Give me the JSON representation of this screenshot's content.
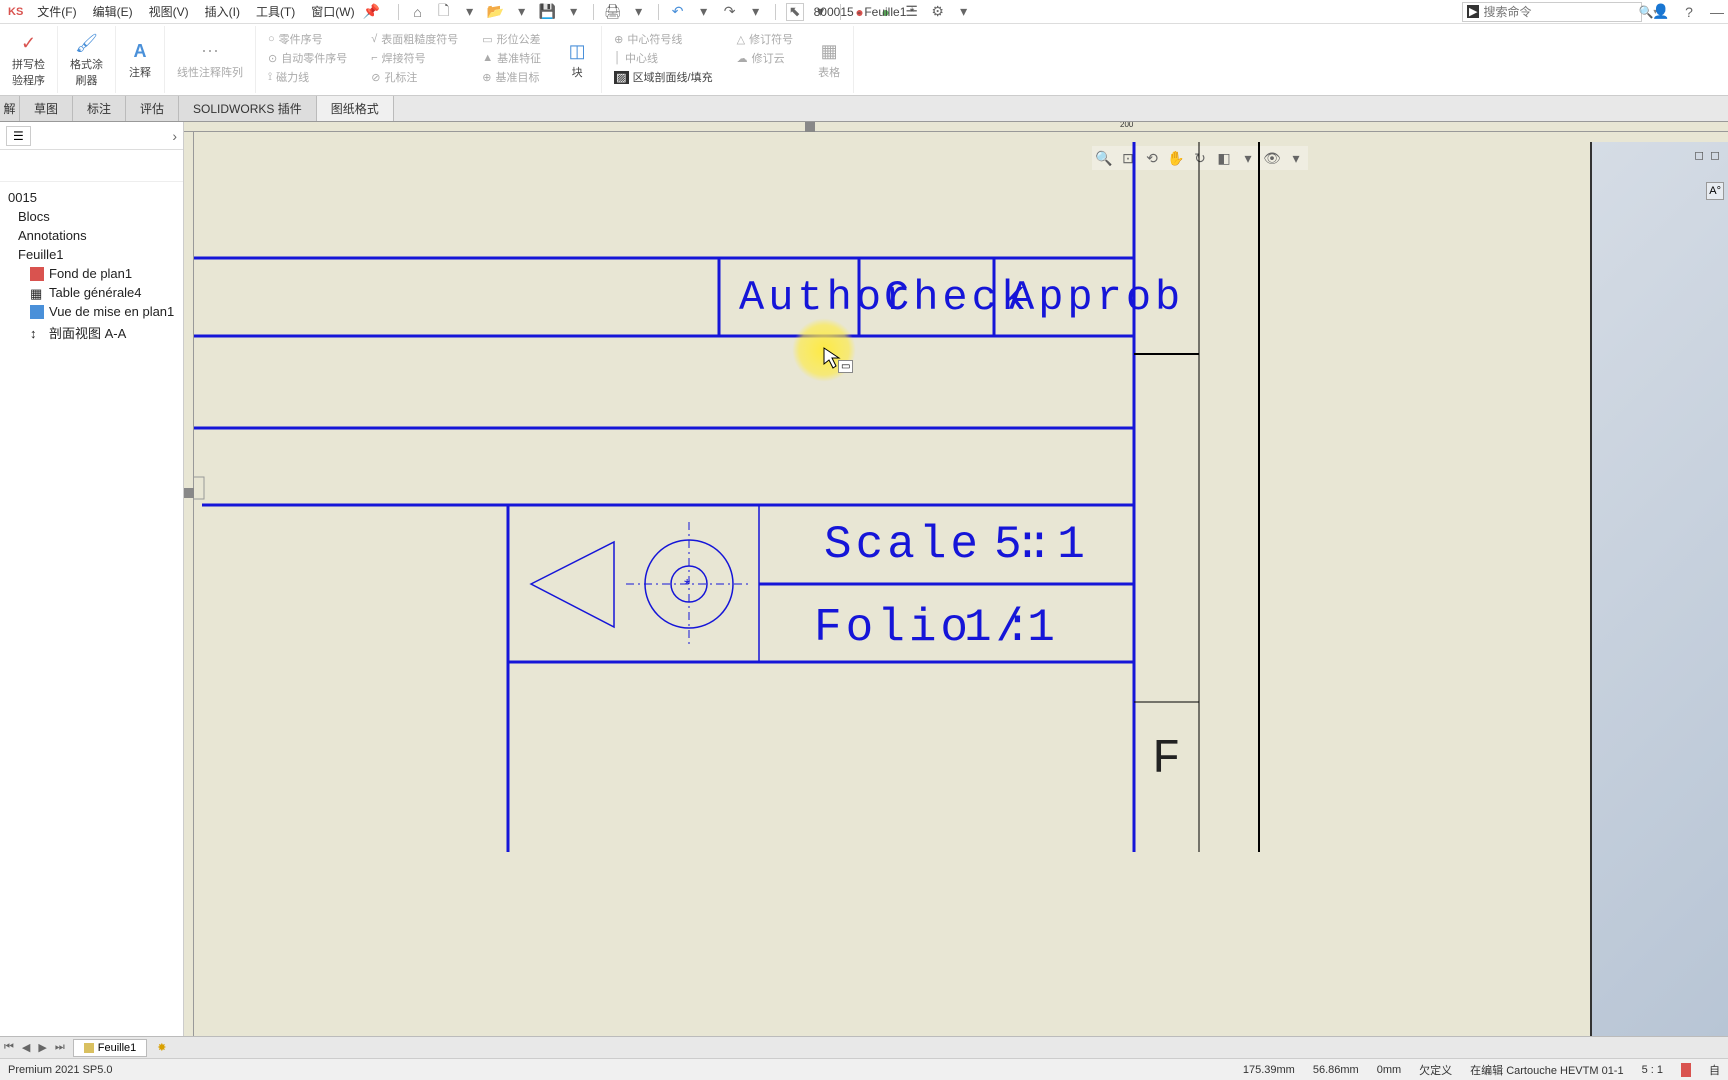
{
  "app": {
    "logo": "KS"
  },
  "menu": {
    "file": "文件(F)",
    "edit": "编辑(E)",
    "view": "视图(V)",
    "insert": "插入(I)",
    "tools": "工具(T)",
    "window": "窗口(W)"
  },
  "doc_title": "800015 - Feuille1 *",
  "search": {
    "placeholder": "搜索命令"
  },
  "ribbon": {
    "spellcheck": "拼写检\n验程序",
    "format_painter": "格式涂\n刷器",
    "note": "注释",
    "linear_pattern": "线性注释阵列",
    "part_number": "零件序号",
    "auto_part_number": "自动零件序号",
    "magnetic_line": "磁力线",
    "surface_finish": "表面粗糙度符号",
    "weld_symbol": "焊接符号",
    "hole_callout": "孔标注",
    "geo_tol": "形位公差",
    "datum_feature": "基准特征",
    "datum_target": "基准目标",
    "block": "块",
    "centerline_mark": "中心符号线",
    "centerline": "中心线",
    "area_hatch": "区域剖面线/填充",
    "rev_symbol": "修订符号",
    "rev_cloud": "修订云",
    "table": "表格"
  },
  "tabs": {
    "hide": "解",
    "sketch": "草图",
    "annotate": "标注",
    "evaluate": "评估",
    "addins": "SOLIDWORKS 插件",
    "sheet_format": "图纸格式"
  },
  "tree": {
    "root": "0015",
    "blocs": "Blocs",
    "annotations": "Annotations",
    "feuille": "Feuille1",
    "fond": "Fond de plan1",
    "table": "Table générale4",
    "vue": "Vue de mise en plan1",
    "section": "剖面视图 A-A"
  },
  "title_block": {
    "author": "Author",
    "check": "Check",
    "approb": "Approb",
    "scale_label": "Scale :",
    "scale_value": "5:1",
    "folio_label": "Folio :",
    "folio_value": "1/1",
    "zone_letter": "F"
  },
  "ruler": {
    "mark_200": "200"
  },
  "sheet_tabs": {
    "feuille": "Feuille1"
  },
  "status": {
    "version": "Premium 2021 SP5.0",
    "x": "175.39mm",
    "y": "56.86mm",
    "z": "0mm",
    "under_defined": "欠定义",
    "editing": "在编辑 Cartouche HEVTM  01-1",
    "scale": "5 : 1",
    "auto": "自"
  }
}
